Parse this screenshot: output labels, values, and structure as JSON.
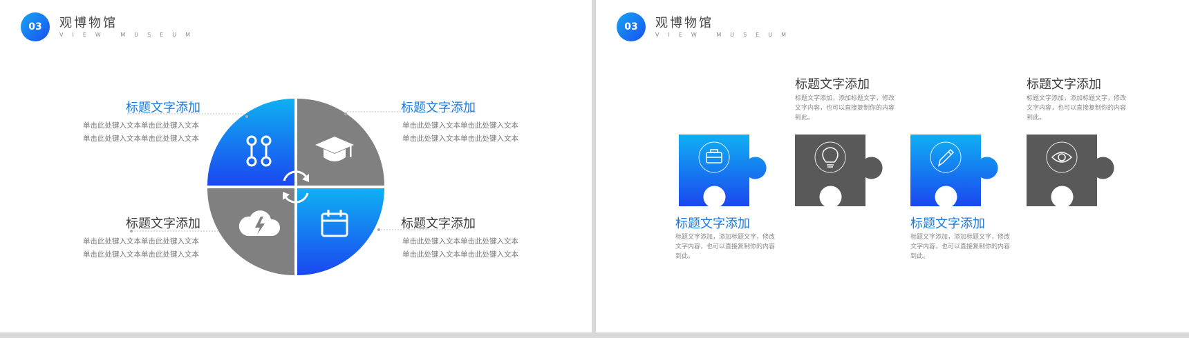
{
  "header": {
    "badge": "03",
    "title": "观博物馆",
    "subtitle": "VIEW MUSEUM"
  },
  "slide1": {
    "items": [
      {
        "title": "标题文字添加",
        "lines": [
          "单击此处键入文本单击此处键入文本",
          "单击此处键入文本单击此处键入文本"
        ]
      },
      {
        "title": "标题文字添加",
        "lines": [
          "单击此处键入文本单击此处键入文本",
          "单击此处键入文本单击此处键入文本"
        ]
      },
      {
        "title": "标题文字添加",
        "lines": [
          "单击此处键入文本单击此处键入文本",
          "单击此处键入文本单击此处键入文本"
        ]
      },
      {
        "title": "标题文字添加",
        "lines": [
          "单击此处键入文本单击此处键入文本",
          "单击此处键入文本单击此处键入文本"
        ]
      }
    ],
    "quadrant_icons": [
      "link-icon",
      "graduation-cap-icon",
      "cloud-lightning-icon",
      "calendar-icon"
    ],
    "center_icon": "refresh-icon"
  },
  "slide2": {
    "items": [
      {
        "title": "标题文字添加",
        "desc": "标题文字添加，添加标题文字，修改文字内容，也可以直接复制你的内容到此。",
        "icon": "briefcase-icon"
      },
      {
        "title": "标题文字添加",
        "desc": "标题文字添加，添加标题文字，修改文字内容，也可以直接复制你的内容到此。",
        "icon": "lightbulb-icon"
      },
      {
        "title": "标题文字添加",
        "desc": "标题文字添加，添加标题文字，修改文字内容，也可以直接复制你的内容到此。",
        "icon": "pencil-icon"
      },
      {
        "title": "标题文字添加",
        "desc": "标题文字添加，添加标题文字，修改文字内容，也可以直接复制你的内容到此。",
        "icon": "eye-icon"
      }
    ]
  },
  "colors": {
    "blue_light": "#0fb0f2",
    "blue_dark": "#1b47f0",
    "gray": "#808080",
    "dark_gray": "#595959",
    "title_blue": "#1a7ae0"
  }
}
